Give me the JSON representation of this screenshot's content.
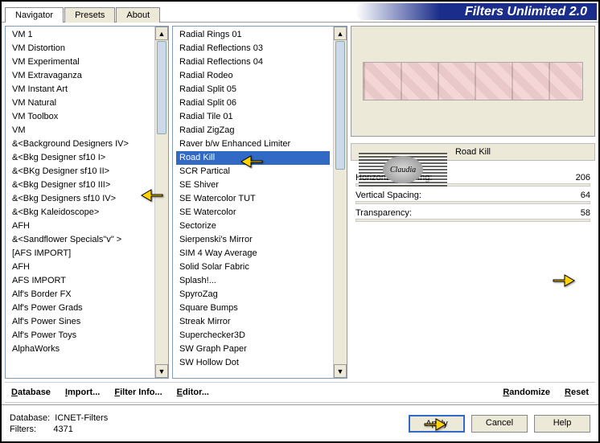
{
  "title": "Filters Unlimited 2.0",
  "tabs": [
    "Navigator",
    "Presets",
    "About"
  ],
  "active_tab": 0,
  "list1": [
    "VM 1",
    "VM Distortion",
    "VM Experimental",
    "VM Extravaganza",
    "VM Instant Art",
    "VM Natural",
    "VM Toolbox",
    "VM",
    "&<Background Designers IV>",
    "&<Bkg Designer sf10 I>",
    "&<BKg Designer sf10 II>",
    "&<Bkg Designer sf10 III>",
    "&<Bkg Designers sf10 IV>",
    "&<Bkg Kaleidoscope>",
    "AFH",
    "&<Sandflower Specials\"v\" >",
    "[AFS IMPORT]",
    "AFH",
    "AFS IMPORT",
    "Alf's Border FX",
    "Alf's Power Grads",
    "Alf's Power Sines",
    "Alf's Power Toys",
    "AlphaWorks"
  ],
  "list1_selected": 11,
  "list2": [
    "Radial  Rings 01",
    "Radial Reflections 03",
    "Radial Reflections 04",
    "Radial Rodeo",
    "Radial Split 05",
    "Radial Split 06",
    "Radial Tile 01",
    "Radial ZigZag",
    "Raver b/w Enhanced Limiter",
    "Road Kill",
    "SCR  Partical",
    "SE Shiver",
    "SE Watercolor TUT",
    "SE Watercolor",
    "Sectorize",
    "Sierpenski's Mirror",
    "SIM 4 Way Average",
    "Solid Solar Fabric",
    "Splash!...",
    "SpyroZag",
    "Square Bumps",
    "Streak Mirror",
    "Superchecker3D",
    "SW Graph Paper",
    "SW Hollow Dot"
  ],
  "list2_selected": 9,
  "current_filter_name": "Road Kill",
  "sliders": [
    {
      "label": "Horizontal Spacing:",
      "value": "206"
    },
    {
      "label": "Vertical Spacing:",
      "value": "64"
    },
    {
      "label": "Transparency:",
      "value": "58"
    }
  ],
  "bottom_actions": {
    "database": "Database",
    "import": "Import...",
    "filter_info": "Filter Info...",
    "editor": "Editor...",
    "randomize": "Randomize",
    "reset": "Reset"
  },
  "footer": {
    "db_label": "Database:",
    "db_value": "ICNET-Filters",
    "filters_label": "Filters:",
    "filters_value": "4371"
  },
  "buttons": {
    "apply": "Apply",
    "cancel": "Cancel",
    "help": "Help"
  },
  "logo_text": "Claudia"
}
